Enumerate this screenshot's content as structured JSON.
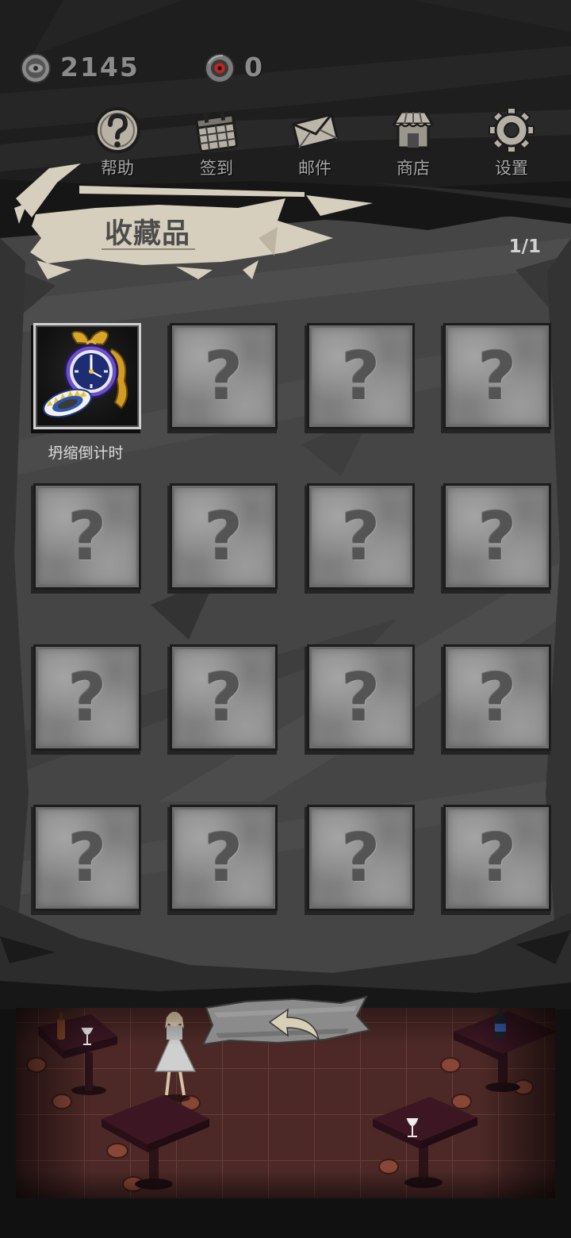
{
  "currencies": [
    {
      "icon": "coin-icon",
      "value": "2145"
    },
    {
      "icon": "eye-token-icon",
      "value": "0"
    }
  ],
  "nav": [
    {
      "label": "帮助",
      "icon": "help-icon"
    },
    {
      "label": "签到",
      "icon": "calendar-icon"
    },
    {
      "label": "邮件",
      "icon": "mail-icon"
    },
    {
      "label": "商店",
      "icon": "shop-icon"
    },
    {
      "label": "设置",
      "icon": "settings-icon"
    }
  ],
  "collection": {
    "title": "收藏品",
    "page": "1/1",
    "locked_glyph": "?",
    "items": [
      {
        "name": "坍缩倒计时",
        "unlocked": true,
        "icon": "pocket-watch-icon"
      },
      {
        "unlocked": false
      },
      {
        "unlocked": false
      },
      {
        "unlocked": false
      },
      {
        "unlocked": false
      },
      {
        "unlocked": false
      },
      {
        "unlocked": false
      },
      {
        "unlocked": false
      },
      {
        "unlocked": false
      },
      {
        "unlocked": false
      },
      {
        "unlocked": false
      },
      {
        "unlocked": false
      },
      {
        "unlocked": false
      },
      {
        "unlocked": false
      },
      {
        "unlocked": false
      },
      {
        "unlocked": false
      }
    ]
  },
  "back_button": {
    "icon": "back-arrow-icon"
  },
  "colors": {
    "background": "#1e1e1e",
    "panel": "#454545",
    "locked_tile": "#8a8a8a",
    "banner_paper": "#d6cfbd",
    "label_text": "#a8a8a8",
    "floor": "#4c2926"
  }
}
